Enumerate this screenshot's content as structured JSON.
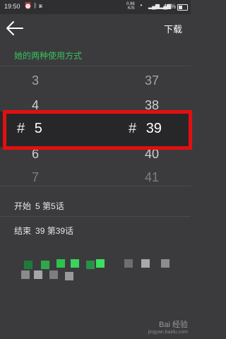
{
  "status": {
    "time": "19:50",
    "net_speed_value": "0.96",
    "net_speed_unit": "K/S",
    "battery": "44%"
  },
  "appbar": {
    "download_label": "下载"
  },
  "section": {
    "title": "她的两种使用方式"
  },
  "picker": {
    "left": [
      "3",
      "4",
      "5",
      "6",
      "7"
    ],
    "right": [
      "37",
      "38",
      "39",
      "40",
      "41"
    ],
    "hash": "#",
    "selected_left": "5",
    "selected_right": "39"
  },
  "range": {
    "start_label": "开始",
    "start_value": "5 第5话",
    "end_label": "结束",
    "end_value": "39 第39话"
  },
  "watermark": {
    "brand": "Bai 经验",
    "url": "jingyan.baidu.com"
  }
}
